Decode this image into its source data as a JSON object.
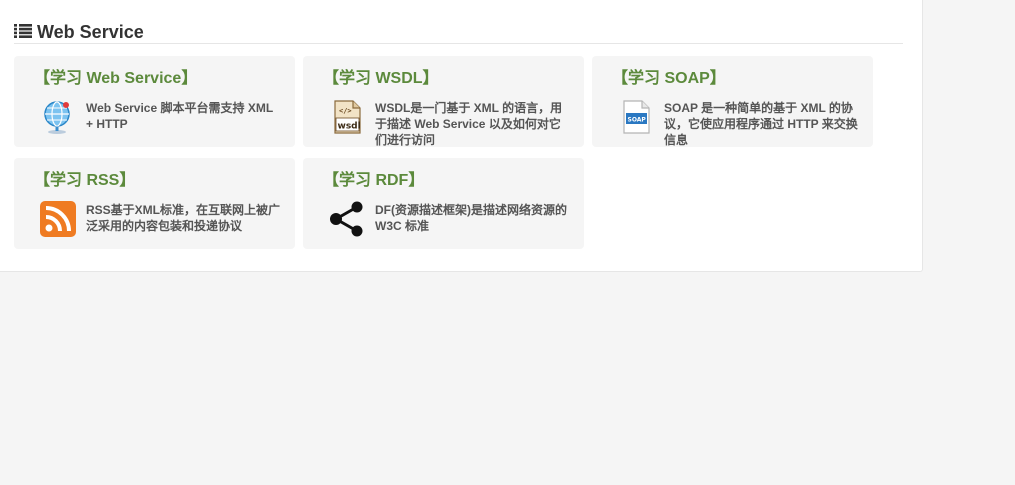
{
  "section": {
    "title": "Web Service",
    "icon": "list-icon"
  },
  "cards": [
    {
      "title": "【学习 Web Service】",
      "description": "Web Service 脚本平台需支持 XML + HTTP",
      "icon": "globe-icon"
    },
    {
      "title": "【学习 WSDL】",
      "description": "WSDL是一门基于 XML 的语言，用于描述 Web Service 以及如何对它们进行访问",
      "icon": "wsdl-file-icon"
    },
    {
      "title": "【学习 SOAP】",
      "description": "SOAP 是一种简单的基于 XML 的协议，它使应用程序通过 HTTP 来交换信息",
      "icon": "soap-file-icon"
    },
    {
      "title": "【学习 RSS】",
      "description": "RSS基于XML标准，在互联网上被广泛采用的内容包装和投递协议",
      "icon": "rss-icon"
    },
    {
      "title": "【学习 RDF】",
      "description": "DF(资源描述框架)是描述网络资源的 W3C 标准",
      "icon": "share-icon"
    }
  ],
  "colors": {
    "title_green": "#5c8a3c",
    "rss_orange": "#ef7b22",
    "card_bg": "#f5f5f5"
  }
}
